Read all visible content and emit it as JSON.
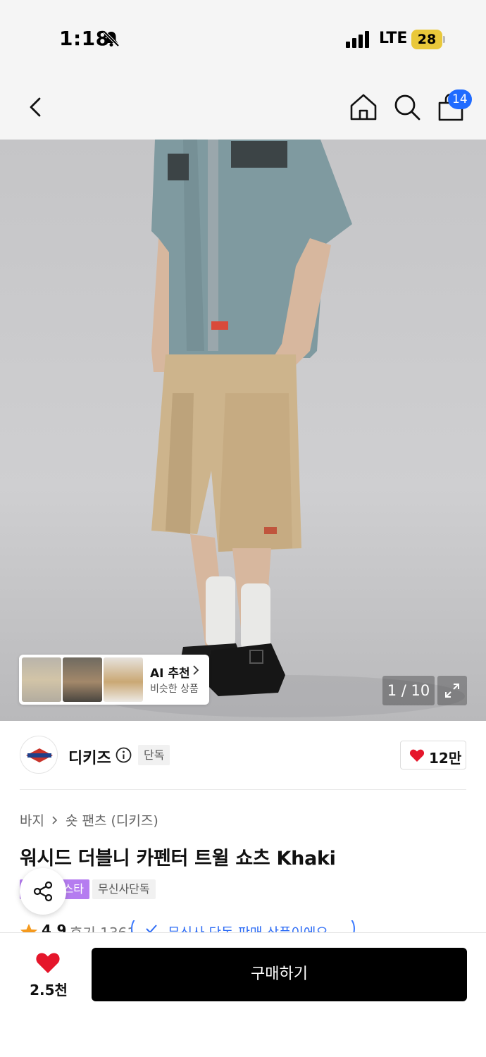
{
  "status_bar": {
    "time": "1:18",
    "network": "LTE",
    "battery": "28"
  },
  "nav": {
    "cart_count": "14"
  },
  "gallery": {
    "ai_title": "AI 추천",
    "ai_subtitle": "비슷한 상품",
    "pager": "1 / 10"
  },
  "brand": {
    "name": "디키즈",
    "exclusive_badge": "단독",
    "like_count": "12만"
  },
  "product": {
    "breadcrumb": [
      "바지",
      "숏 팬츠 (디키즈)"
    ],
    "title": "워시드 더블니 카펜터 트윌 쇼츠 Khaki",
    "tag_purple": "스타",
    "tag_gray": "무신사단독",
    "rating": "4.9",
    "review_text": "후기 1361",
    "exclusive_pill": "무신사 단독 판매 상품이에요"
  },
  "bottom": {
    "wish_count": "2.5천",
    "buy_label": "구매하기"
  },
  "colors": {
    "accent_blue": "#1f6bff",
    "heart_red": "#e5162b",
    "tag_purple": "#b57cf0",
    "buy_button": "#000000"
  },
  "icons": [
    "bell-slash-icon",
    "signal-icon",
    "back-icon",
    "home-icon",
    "search-icon",
    "bag-icon",
    "chevron-right-icon",
    "expand-icon",
    "info-icon",
    "heart-icon",
    "share-icon",
    "star-icon",
    "check-icon"
  ]
}
